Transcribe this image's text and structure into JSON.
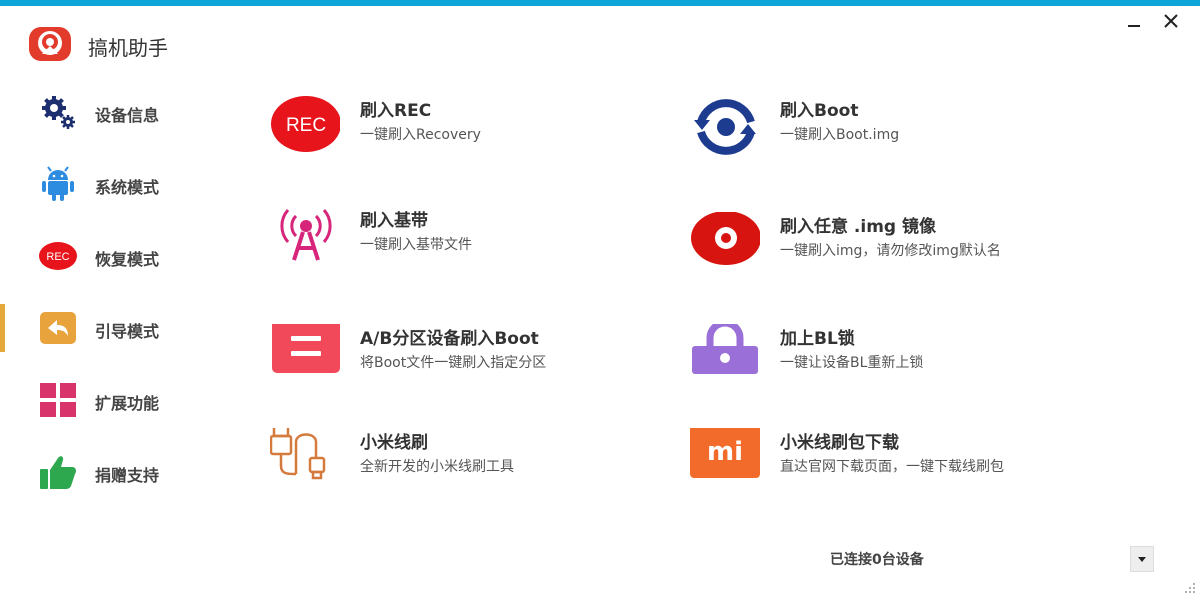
{
  "window": {
    "title": "搞机助手"
  },
  "sidebar": {
    "items": [
      {
        "label": "设备信息",
        "icon": "gears-icon"
      },
      {
        "label": "系统模式",
        "icon": "android-icon"
      },
      {
        "label": "恢复模式",
        "icon": "rec-icon"
      },
      {
        "label": "引导模式",
        "icon": "back-arrow-icon",
        "active": true
      },
      {
        "label": "扩展功能",
        "icon": "grid-icon"
      },
      {
        "label": "捐赠支持",
        "icon": "thumbs-up-icon"
      }
    ]
  },
  "rec_icon_text": "REC",
  "features": [
    {
      "title": "刷入REC",
      "desc": "一键刷入Recovery",
      "icon": "rec-circle-icon"
    },
    {
      "title": "刷入Boot",
      "desc": "一键刷入Boot.img",
      "icon": "boot-circle-icon"
    },
    {
      "title": "刷入基带",
      "desc": "一键刷入基带文件",
      "icon": "antenna-icon"
    },
    {
      "title": "刷入任意 .img 镜像",
      "desc": "一键刷入img，请勿修改img默认名",
      "icon": "disc-icon"
    },
    {
      "title": "A/B分区设备刷入Boot",
      "desc": "将Boot文件一键刷入指定分区",
      "icon": "ab-partition-icon"
    },
    {
      "title": "加上BL锁",
      "desc": "一键让设备BL重新上锁",
      "icon": "lock-icon"
    },
    {
      "title": "小米线刷",
      "desc": "全新开发的小米线刷工具",
      "icon": "usb-cable-icon"
    },
    {
      "title": "小米线刷包下载",
      "desc": "直达官网下载页面，一键下载线刷包",
      "icon": "mi-logo-icon"
    }
  ],
  "mi_logo_text": "mi",
  "status": {
    "text": "已连接0台设备"
  },
  "colors": {
    "accent": "#0ea5d8",
    "active_marker": "#e5a83a",
    "rec_red": "#e8141b",
    "boot_blue": "#1d3c8f",
    "antenna_pink": "#d6257a",
    "ab_red": "#f1495a",
    "lock_purple": "#9b6fd8",
    "usb_orange": "#d47a3c",
    "mi_orange": "#f26b2b"
  }
}
